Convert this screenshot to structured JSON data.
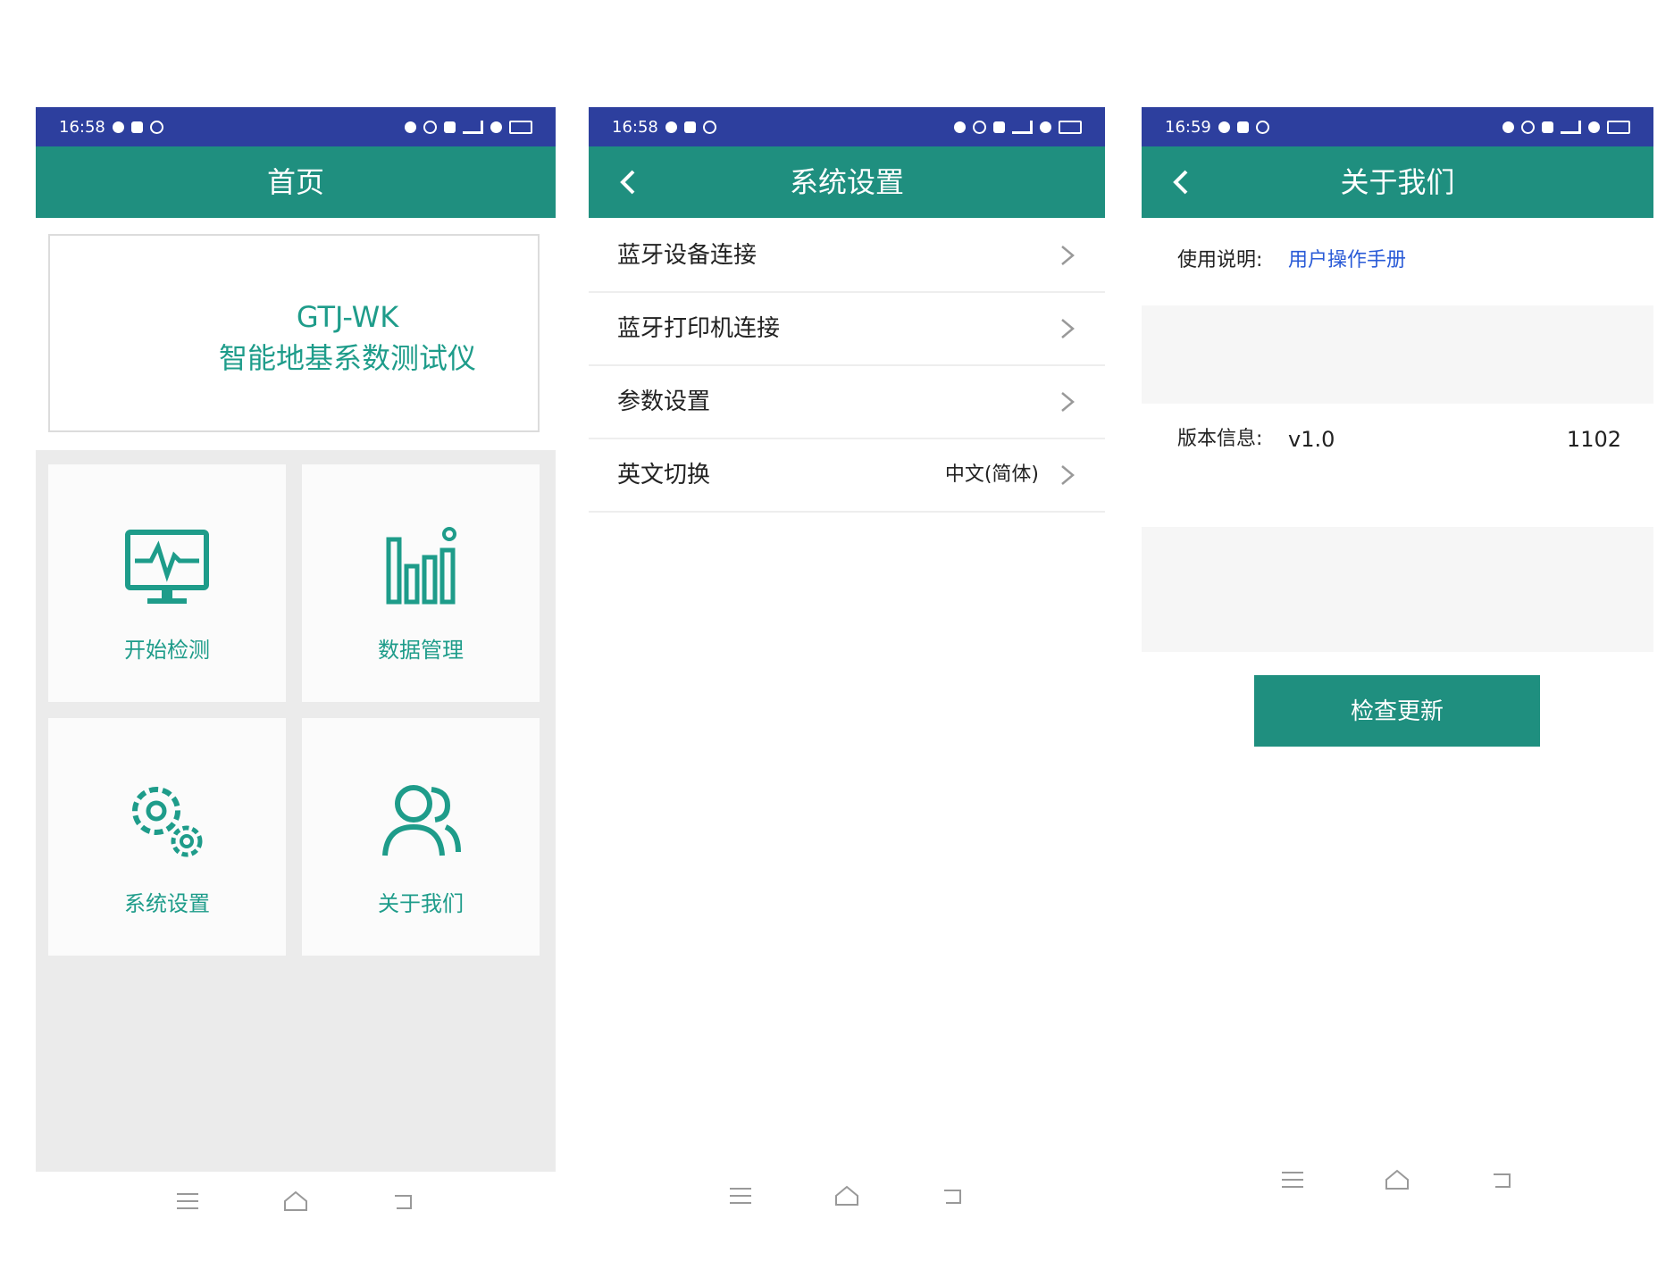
{
  "colors": {
    "status_bar": "#2d3f9e",
    "app_bar": "#1f8f7f",
    "accent": "#1e9c8a",
    "link": "#2a5bd7"
  },
  "home": {
    "status_time": "16:58",
    "title": "首页",
    "banner": {
      "model": "GTJ-WK",
      "name": "智能地基系数测试仪"
    },
    "tiles": [
      {
        "label": "开始检测",
        "icon": "monitor-heartbeat-icon"
      },
      {
        "label": "数据管理",
        "icon": "bar-chart-icon"
      },
      {
        "label": "系统设置",
        "icon": "gears-icon"
      },
      {
        "label": "关于我们",
        "icon": "users-icon"
      }
    ]
  },
  "settings": {
    "status_time": "16:58",
    "title": "系统设置",
    "items": [
      {
        "label": "蓝牙设备连接",
        "value": ""
      },
      {
        "label": "蓝牙打印机连接",
        "value": ""
      },
      {
        "label": "参数设置",
        "value": ""
      },
      {
        "label": "英文切换",
        "value": "中文(简体)"
      }
    ]
  },
  "about": {
    "status_time": "16:59",
    "title": "关于我们",
    "manual_label": "使用说明:",
    "manual_link": "用户操作手册",
    "version_label": "版本信息:",
    "version_value": "v1.0",
    "version_code": "1102",
    "update_button": "检查更新"
  }
}
